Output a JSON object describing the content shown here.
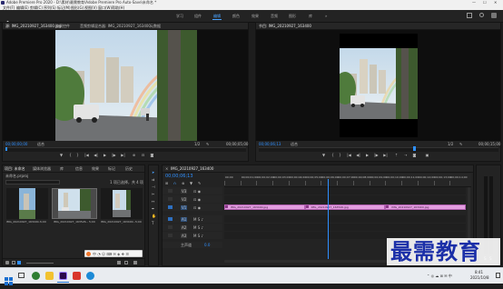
{
  "window": {
    "title": "Adobe Premiere Pro 2020 - D:\\素材\\最需教育\\Adobe Premiere Pro Auto-Save\\未命名 *",
    "controls": [
      "—",
      "☐",
      "✕"
    ]
  },
  "menu": [
    "文件(F)",
    "编辑(E)",
    "剪辑(C)",
    "序列(S)",
    "标记(M)",
    "图形(G)",
    "视图(V)",
    "窗口(W)",
    "帮助(H)"
  ],
  "workspaces": [
    "学习",
    "组件",
    "编辑",
    "颜色",
    "效果",
    "音频",
    "图形",
    "库"
  ],
  "workspaces_active_index": 2,
  "source_monitor": {
    "tabs": [
      "源: IMG_20210927_163400.jpg",
      "效果控件",
      "音频剪辑混合器: IMG_20210927_163400",
      "元数据"
    ],
    "timecode_left": "00;00;00;00",
    "fit": "适合",
    "ratio": "1/2",
    "timecode_right": "00;00;05;00"
  },
  "program_monitor": {
    "tab": "节目: IMG_20210927_163400",
    "timecode_left": "00;00;06;13",
    "fit": "适合",
    "ratio": "1/2",
    "timecode_right": "00;00;15;00"
  },
  "project_panel": {
    "tabs": [
      "项目: 未命名",
      "媒体浏览器",
      "库",
      "信息",
      "效果",
      "标记",
      "历史"
    ],
    "project_name": "未命名.prproj",
    "search_placeholder": "",
    "item_count": "1 项已选择，共 4 项",
    "items": [
      {
        "name": "IMG_20210927_163400...",
        "duration": "5;00"
      },
      {
        "name": "IMG_20210927_163526...",
        "duration": "5;00"
      },
      {
        "name": "IMG_20210927_163400...",
        "duration": "5;00"
      }
    ]
  },
  "timeline": {
    "tab": "IMG_20210927_163400",
    "timecode": "00;00;06;13",
    "ruler_labels": [
      "00;00",
      "00;00;01;00",
      "00;00;02;00",
      "00;00;03;00",
      "00;00;04;00",
      "00;00;05;00",
      "00;00;06;00",
      "00;00;07;00",
      "00;00;08;00",
      "00;00;09;00",
      "00;00;10;00",
      "00;00;11;00",
      "00;00;12;00",
      "00;00;13;00",
      "00;00;14;00"
    ],
    "tracks": [
      "V3",
      "V2",
      "V1",
      "A1",
      "A2",
      "A3"
    ],
    "master_label": "主声道",
    "master_value": "0.0",
    "clips": [
      {
        "name": "IMG_20210927_163400.jpg",
        "start": 0,
        "end": 5
      },
      {
        "name": "IMG_20210927_163526.jpg",
        "start": 5,
        "end": 10
      },
      {
        "name": "IMG_20210927_163400.jpg",
        "start": 10,
        "end": 15
      }
    ]
  },
  "watermark": "最需教育",
  "taskbar": {
    "time": "8:41",
    "date": "2021/10/8"
  }
}
